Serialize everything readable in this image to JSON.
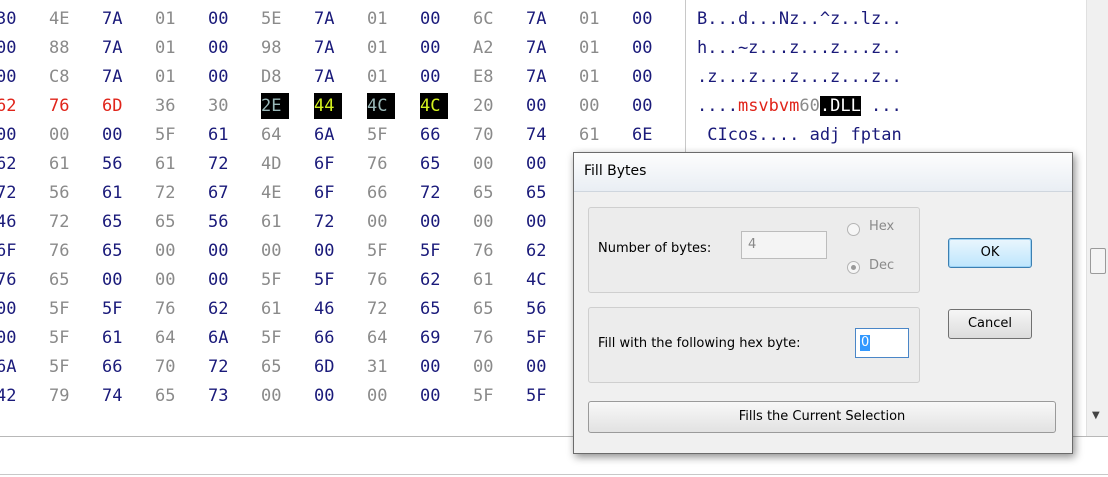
{
  "colors": {
    "hex_default": "#1a1a7a",
    "hex_alt": "#8a8a8a",
    "highlight_red": "#e0241a",
    "selection_green": "#d4f21e",
    "selection_bg": "#000000"
  },
  "hex_view": {
    "rows": [
      {
        "bytes": [
          "30",
          "4E",
          "7A",
          "01",
          "00",
          "5E",
          "7A",
          "01",
          "00",
          "6C",
          "7A",
          "01",
          "00"
        ],
        "ascii": "B...d...Nz..^z..lz.."
      },
      {
        "bytes": [
          "00",
          "88",
          "7A",
          "01",
          "00",
          "98",
          "7A",
          "01",
          "00",
          "A2",
          "7A",
          "01",
          "00"
        ],
        "ascii": "h...~z...z...z...z.."
      },
      {
        "bytes": [
          "00",
          "C8",
          "7A",
          "01",
          "00",
          "D8",
          "7A",
          "01",
          "00",
          "E8",
          "7A",
          "01",
          "00"
        ],
        "ascii": ".z...z...z...z...z.."
      },
      {
        "bytes": [
          "62",
          "76",
          "6D",
          "36",
          "30",
          "2E",
          "44",
          "4C",
          "4C",
          "20",
          "00",
          "00",
          "00"
        ],
        "ascii_parts": [
          "....",
          "msvbvm",
          "60",
          ".DLL",
          " ..."
        ]
      },
      {
        "bytes": [
          "00",
          "00",
          "00",
          "5F",
          "61",
          "64",
          "6A",
          "5F",
          "66",
          "70",
          "74",
          "61",
          "6E"
        ],
        "ascii": " CIcos.... adj fptan"
      },
      {
        "bytes": [
          "62",
          "61",
          "56",
          "61",
          "72",
          "4D",
          "6F",
          "76",
          "65",
          "00",
          "00"
        ]
      },
      {
        "bytes": [
          "72",
          "56",
          "61",
          "72",
          "67",
          "4E",
          "6F",
          "66",
          "72",
          "65",
          "65"
        ]
      },
      {
        "bytes": [
          "46",
          "72",
          "65",
          "65",
          "56",
          "61",
          "72",
          "00",
          "00",
          "00",
          "00"
        ]
      },
      {
        "bytes": [
          "6F",
          "76",
          "65",
          "00",
          "00",
          "00",
          "00",
          "5F",
          "5F",
          "76",
          "62"
        ]
      },
      {
        "bytes": [
          "76",
          "65",
          "00",
          "00",
          "00",
          "5F",
          "5F",
          "76",
          "62",
          "61",
          "4C"
        ]
      },
      {
        "bytes": [
          "00",
          "5F",
          "5F",
          "76",
          "62",
          "61",
          "46",
          "72",
          "65",
          "65",
          "56"
        ]
      },
      {
        "bytes": [
          "00",
          "5F",
          "61",
          "64",
          "6A",
          "5F",
          "66",
          "64",
          "69",
          "76",
          "5F"
        ]
      },
      {
        "bytes": [
          "6A",
          "5F",
          "66",
          "70",
          "72",
          "65",
          "6D",
          "31",
          "00",
          "00",
          "00"
        ]
      },
      {
        "bytes": [
          "42",
          "79",
          "74",
          "65",
          "73",
          "00",
          "00",
          "00",
          "00",
          "5F",
          "5F"
        ]
      }
    ]
  },
  "dialog": {
    "title": "Fill Bytes",
    "number_of_bytes_label": "Number of bytes:",
    "number_of_bytes_value": "4",
    "radio_hex_label": "Hex",
    "radio_dec_label": "Dec",
    "radio_selected": "Dec",
    "fill_label": "Fill with the following hex byte:",
    "fill_value": "0",
    "ok_label": "OK",
    "cancel_label": "Cancel",
    "fill_selection_label": "Fills the Current Selection"
  },
  "scrollbar": {
    "down_arrow": "▼"
  }
}
